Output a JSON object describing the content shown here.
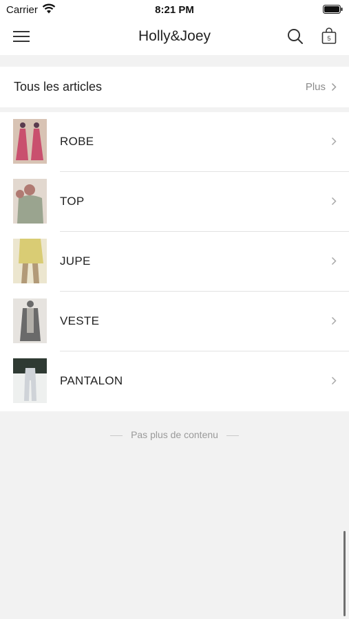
{
  "status_bar": {
    "carrier": "Carrier",
    "time": "8:21 PM"
  },
  "nav": {
    "title": "Holly&Joey",
    "cart_count": "5",
    "menu_icon": "hamburger-menu-icon",
    "search_icon": "search-icon",
    "cart_icon": "shopping-bag-icon"
  },
  "section": {
    "title": "Tous les articles",
    "more_label": "Plus"
  },
  "categories": [
    {
      "label": "ROBE",
      "thumb_colors": [
        "#c9506e",
        "#5a3b4e",
        "#d8c3b4"
      ]
    },
    {
      "label": "TOP",
      "thumb_colors": [
        "#9aa48f",
        "#b07a72",
        "#e2d8cf"
      ]
    },
    {
      "label": "JUPE",
      "thumb_colors": [
        "#d9cc74",
        "#b29a78",
        "#ece6cf"
      ]
    },
    {
      "label": "VESTE",
      "thumb_colors": [
        "#6a6a6a",
        "#b3b0aa",
        "#e6e3df"
      ]
    },
    {
      "label": "PANTALON",
      "thumb_colors": [
        "#cfd3d8",
        "#2f3a33",
        "#eef0ef"
      ]
    }
  ],
  "footer": {
    "end_text": "Pas plus de contenu"
  },
  "colors": {
    "background": "#f2f2f2",
    "text": "#222222",
    "muted": "#8a8a8a"
  }
}
